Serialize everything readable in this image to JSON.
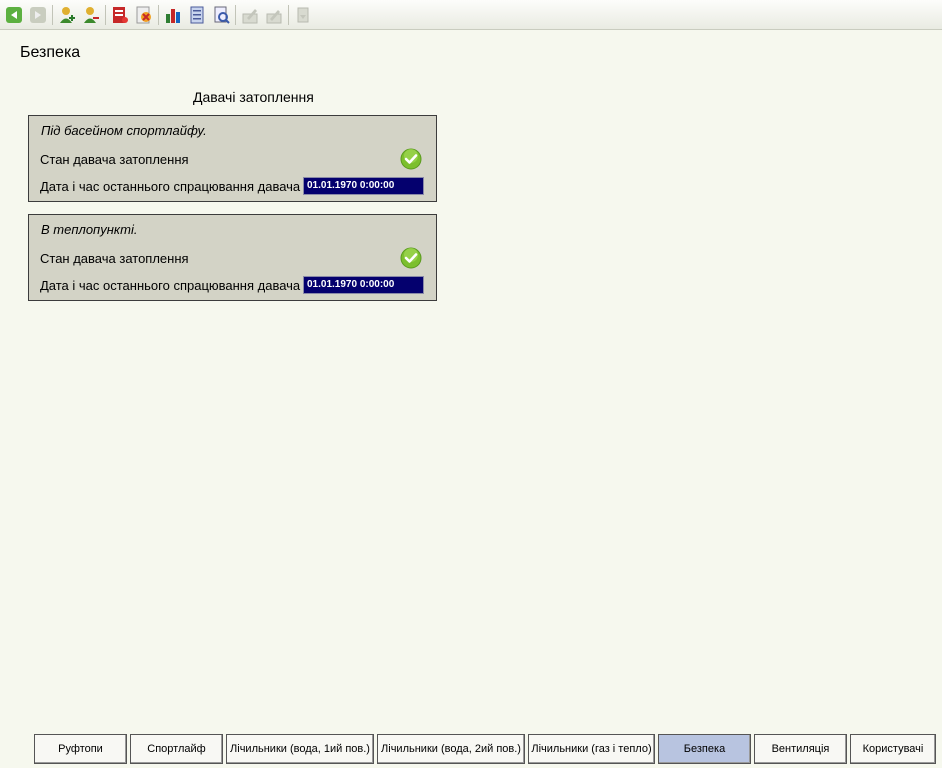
{
  "toolbar": {
    "buttons": [
      {
        "icon": "back-arrow-icon"
      },
      {
        "icon": "forward-arrow-icon"
      },
      {
        "icon": "user-add-icon"
      },
      {
        "icon": "user-remove-icon"
      },
      {
        "icon": "report-red-icon"
      },
      {
        "icon": "report-delete-icon"
      },
      {
        "icon": "bar-chart-icon"
      },
      {
        "icon": "document-list-icon"
      },
      {
        "icon": "print-preview-icon"
      },
      {
        "icon": "edit-disabled-icon"
      },
      {
        "icon": "edit-pen-disabled-icon"
      },
      {
        "icon": "export-disabled-icon"
      }
    ]
  },
  "page": {
    "title": "Безпека",
    "section_title": "Давачі затоплення"
  },
  "panels": [
    {
      "name": "Під басейном спортлайфу.",
      "state_label": "Стан давача затоплення",
      "state_ok": true,
      "date_label": "Дата і час останнього спрацювання давача",
      "date_value": "01.01.1970 0:00:00"
    },
    {
      "name": "В теплопункті.",
      "state_label": "Стан давача затоплення",
      "state_ok": true,
      "date_label": "Дата і час останнього спрацювання давача",
      "date_value": "01.01.1970 0:00:00"
    }
  ],
  "nav": [
    {
      "label": "Руфтопи",
      "active": false
    },
    {
      "label": "Спортлайф",
      "active": false
    },
    {
      "label": "Лічильники (вода, 1ий пов.)",
      "active": false
    },
    {
      "label": "Лічильники (вода, 2ий пов.)",
      "active": false
    },
    {
      "label": "Лічильники (газ і тепло)",
      "active": false
    },
    {
      "label": "Безпека",
      "active": true
    },
    {
      "label": "Вентиляція",
      "active": false
    },
    {
      "label": "Користувачі",
      "active": false
    }
  ],
  "colors": {
    "accent": "#b8c4e0",
    "panel": "#d3d3c6",
    "date_field": "#04006e",
    "ok": "#7cbf2e"
  }
}
